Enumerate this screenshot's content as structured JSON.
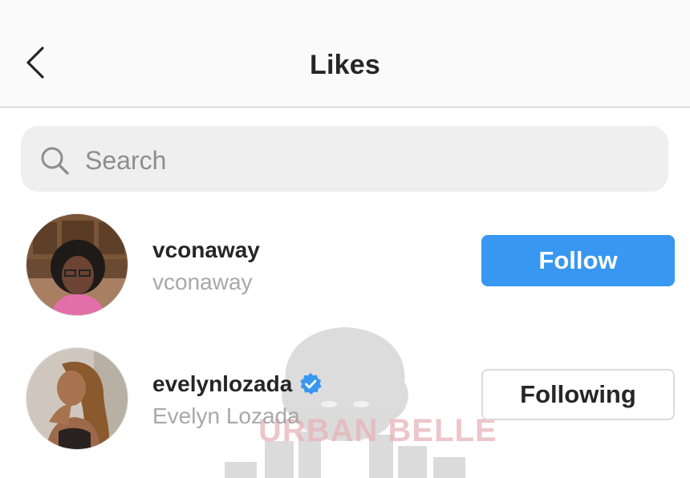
{
  "header": {
    "title": "Likes",
    "back_icon": "chevron-left-icon"
  },
  "search": {
    "placeholder": "Search",
    "value": "",
    "icon": "search-icon"
  },
  "users": [
    {
      "username": "vconaway",
      "full_name": "vconaway",
      "verified": false,
      "button_label": "Follow",
      "button_state": "follow"
    },
    {
      "username": "evelynlozada",
      "full_name": "Evelyn Lozada",
      "verified": true,
      "button_label": "Following",
      "button_state": "following"
    }
  ],
  "watermark": {
    "text": "URBAN BELLE"
  },
  "colors": {
    "accent": "#3897f0",
    "verified_badge": "#3897f0",
    "secondary_text": "#a8a8a8",
    "search_bg": "#efefef"
  }
}
